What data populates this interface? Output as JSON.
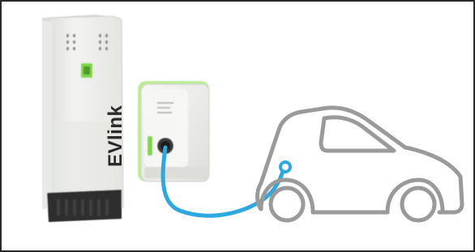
{
  "illustration": {
    "brand_text": "EVlink"
  },
  "colors": {
    "frame_border": "#2a2a2a",
    "cable": "#2fa8e0",
    "car_outline": "#9a9a9a",
    "station_body": "#eeeeec",
    "station_shadow": "#d4d6d1",
    "station_base": "#2e2e2e",
    "accent_green": "#7fd648",
    "wallbox_body": "#f1f1ef",
    "brand_text": "#2b2b2b"
  },
  "icons": [
    "charging-station-icon",
    "wallbox-charger-icon",
    "charging-cable-icon",
    "electric-car-outline-icon"
  ]
}
